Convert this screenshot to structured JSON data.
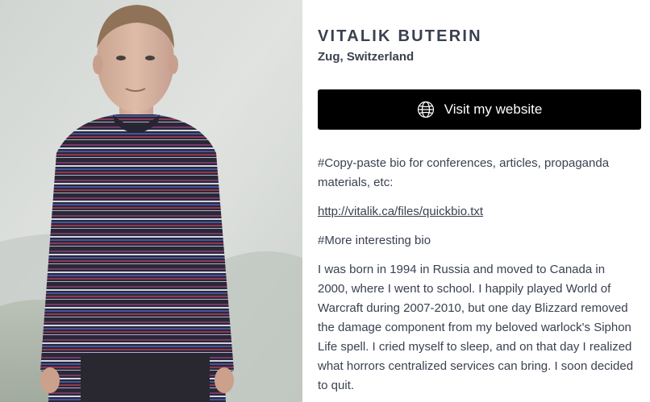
{
  "profile": {
    "name": "VITALIK BUTERIN",
    "location": "Zug, Switzerland"
  },
  "website_button": {
    "label": "Visit my website",
    "icon": "globe-icon"
  },
  "bio": {
    "heading_1": "#Copy-paste bio for conferences, articles, propaganda materials, etc:",
    "link": "http://vitalik.ca/files/quickbio.txt",
    "heading_2": "#More interesting bio",
    "paragraph": "I was born in 1994 in Russia and moved to Canada in 2000, where I went to school. I happily played World of Warcraft during 2007-2010, but one day Blizzard removed the damage component from my beloved warlock's Siphon Life spell. I cried myself to sleep, and on that day I realized what horrors centralized services can bring. I soon decided to quit."
  },
  "colors": {
    "text": "#3a4150",
    "button_bg": "#000000",
    "button_text": "#ffffff",
    "photo_fog": "#d8dbd8"
  }
}
